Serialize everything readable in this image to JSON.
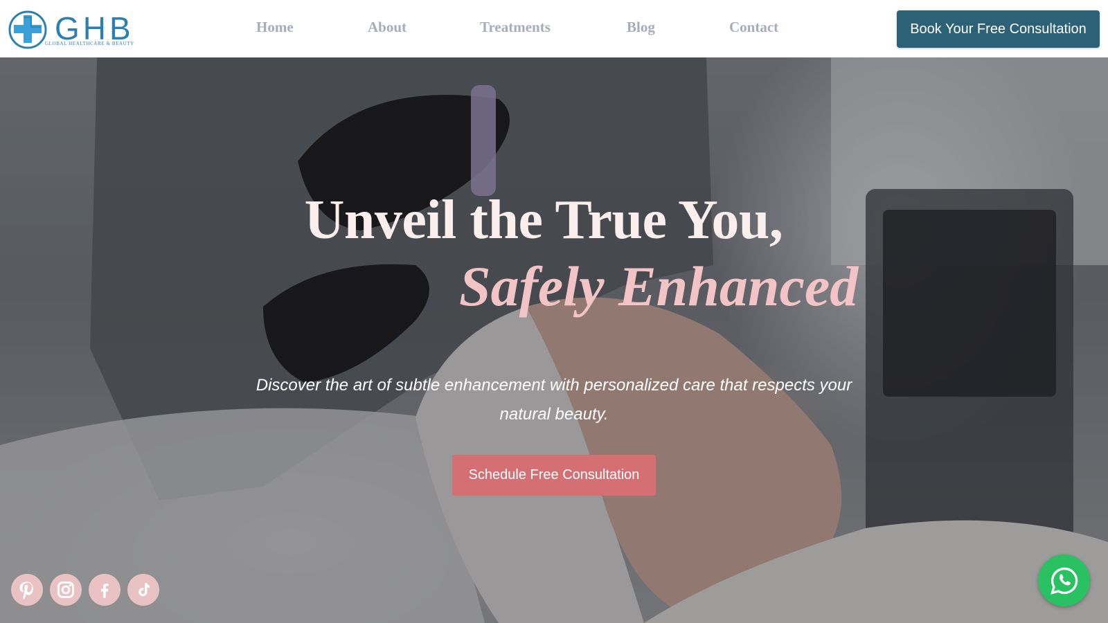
{
  "header": {
    "logo": {
      "text": "GHB",
      "subtitle": "Global Healthcare  & Beauty",
      "icon": "medical-cross-icon"
    },
    "nav": [
      {
        "label": "Home"
      },
      {
        "label": "About"
      },
      {
        "label": "Treatments"
      },
      {
        "label": "Blog"
      },
      {
        "label": "Contact"
      }
    ],
    "cta_label": "Book Your Free Consultation"
  },
  "hero": {
    "headline_line1": "Unveil the True You,",
    "headline_line2": "Safely Enhanced",
    "subtext": "Discover the art of subtle enhancement with personalized care that respects your natural beauty.",
    "cta_label": "Schedule Free Consultation",
    "background_image": "facial-treatment-photo"
  },
  "socials": [
    {
      "icon": "pinterest-icon"
    },
    {
      "icon": "instagram-icon"
    },
    {
      "icon": "facebook-icon"
    },
    {
      "icon": "tiktok-icon"
    }
  ],
  "chat_widget": {
    "icon": "whatsapp-icon"
  },
  "colors": {
    "logo_blue": "#2b7fb3",
    "nav_text": "#a6adb7",
    "header_cta_bg": "#2d6175",
    "hero_cta_bg": "#d46f73",
    "headline_pink": "#f2c4c6",
    "social_icon_bg": "#e9c3c3",
    "whatsapp_green": "#29c161"
  }
}
